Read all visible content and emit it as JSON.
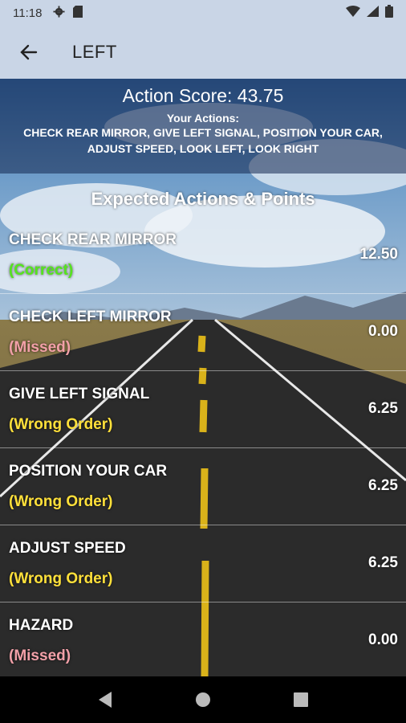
{
  "status_bar": {
    "time": "11:18"
  },
  "app_bar": {
    "title": "LEFT"
  },
  "summary": {
    "score": "Action Score: 43.75",
    "your_actions_label": "Your Actions:",
    "your_actions": "CHECK REAR MIRROR, GIVE LEFT SIGNAL, POSITION YOUR CAR, ADJUST SPEED, LOOK LEFT, LOOK RIGHT"
  },
  "expected": {
    "title": "Expected Actions & Points",
    "rows": [
      {
        "name": "CHECK REAR MIRROR",
        "status": "(Correct)",
        "points": "12.50"
      },
      {
        "name": "CHECK LEFT MIRROR",
        "status": "(Missed)",
        "points": "0.00"
      },
      {
        "name": "GIVE LEFT SIGNAL",
        "status": "(Wrong Order)",
        "points": "6.25"
      },
      {
        "name": "POSITION YOUR CAR",
        "status": "(Wrong Order)",
        "points": "6.25"
      },
      {
        "name": "ADJUST SPEED",
        "status": "(Wrong Order)",
        "points": "6.25"
      },
      {
        "name": "HAZARD",
        "status": "(Missed)",
        "points": "0.00"
      }
    ]
  },
  "colors": {
    "app_bar": "#c9d5e6",
    "correct": "#55e41e",
    "missed": "#f2a0a8",
    "wrong_order": "#ffe03a"
  }
}
